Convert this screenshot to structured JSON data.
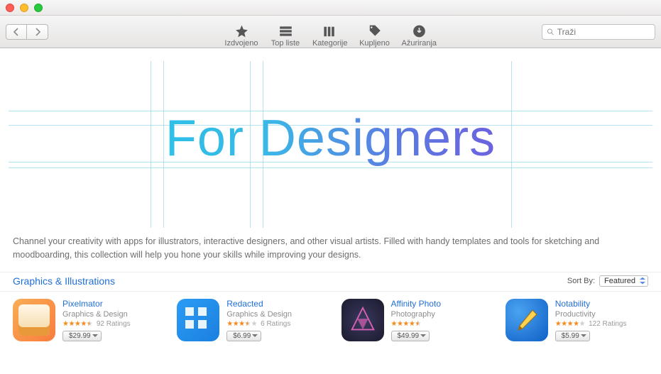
{
  "toolbar": {
    "tabs": [
      {
        "label": "Izdvojeno"
      },
      {
        "label": "Top liste"
      },
      {
        "label": "Kategorije"
      },
      {
        "label": "Kupljeno"
      },
      {
        "label": "Ažuriranja"
      }
    ],
    "search_placeholder": "Traži"
  },
  "hero": {
    "title": "For Designers",
    "blurb": "Channel your creativity with apps for illustrators, interactive designers, and other visual artists. Filled with handy templates and tools for sketching and moodboarding, this collection will help you hone your skills while improving your designs."
  },
  "section": {
    "title": "Graphics & Illustrations",
    "sort_label": "Sort By:",
    "sort_value": "Featured"
  },
  "apps": [
    {
      "name": "Pixelmator",
      "category": "Graphics & Design",
      "rating": 4.5,
      "ratings_text": "92 Ratings",
      "price": "$29.99"
    },
    {
      "name": "Redacted",
      "category": "Graphics & Design",
      "rating": 3.5,
      "ratings_text": "6 Ratings",
      "price": "$6.99"
    },
    {
      "name": "Affinity Photo",
      "category": "Photography",
      "rating": 4.5,
      "ratings_text": "",
      "price": "$49.99"
    },
    {
      "name": "Notability",
      "category": "Productivity",
      "rating": 4.0,
      "ratings_text": "122 Ratings",
      "price": "$5.99"
    }
  ]
}
